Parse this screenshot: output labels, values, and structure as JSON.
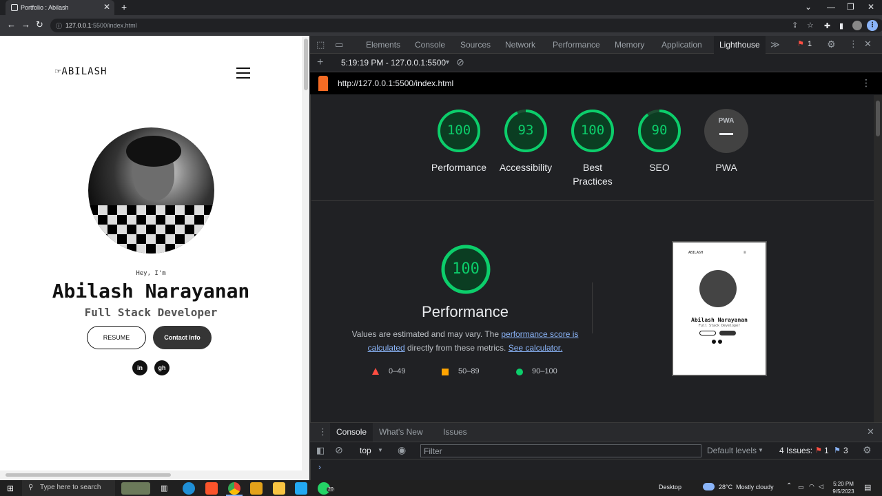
{
  "browser": {
    "tab_title": "Portfolio : Abilash",
    "url_host": "127.0.0.1",
    "url_rest": ":5500/index.html"
  },
  "site": {
    "logo": "☞ABILASH",
    "greeting": "Hey, I'm",
    "name": "Abilash Narayanan",
    "role": "Full Stack Developer",
    "resume_label": "RESUME",
    "contact_label": "Contact Info",
    "linkedin": "in",
    "github": "gh"
  },
  "devtools": {
    "tabs": [
      "Elements",
      "Console",
      "Sources",
      "Network",
      "Performance",
      "Memory",
      "Application",
      "Lighthouse"
    ],
    "active_tab": "Lighthouse",
    "issues_badge": "1",
    "report_time": "5:19:19 PM - 127.0.0.1:5500",
    "report_url": "http://127.0.0.1:5500/index.html",
    "scores": [
      {
        "label": "Performance",
        "value": "100",
        "fraction": 1.0
      },
      {
        "label": "Accessibility",
        "value": "93",
        "fraction": 0.93
      },
      {
        "label": "Best\nPractices",
        "value": "100",
        "fraction": 1.0
      },
      {
        "label": "SEO",
        "value": "90",
        "fraction": 0.9
      },
      {
        "label": "PWA",
        "value": "PWA",
        "fraction": 0
      }
    ],
    "perf_score": "100",
    "perf_title": "Performance",
    "perf_desc_1": "Values are estimated and may vary. The ",
    "perf_link_1": "performance score is calculated",
    "perf_desc_2": " directly from these metrics. ",
    "perf_link_2": "See calculator.",
    "legend": [
      "0–49",
      "50–89",
      "90–100"
    ],
    "thumb": {
      "logo": "ABILASH",
      "name": "Abilash Narayanan",
      "role": "Full Stack Developer"
    },
    "drawer_tabs": [
      "Console",
      "What's New",
      "Issues"
    ],
    "context": "top",
    "filter_placeholder": "Filter",
    "levels": "Default levels",
    "issues_text": "4 Issues:",
    "issues_red": "1",
    "issues_blue": "3"
  },
  "taskbar": {
    "search": "Type here to search",
    "desktop": "Desktop",
    "weather": "28°C  Mostly cloudy",
    "time": "5:20 PM",
    "date": "9/5/2023",
    "whatsapp_badge": "20"
  },
  "colors": {
    "good": "#0cce6b",
    "average": "#ffa400",
    "fail": "#ff4e42"
  }
}
